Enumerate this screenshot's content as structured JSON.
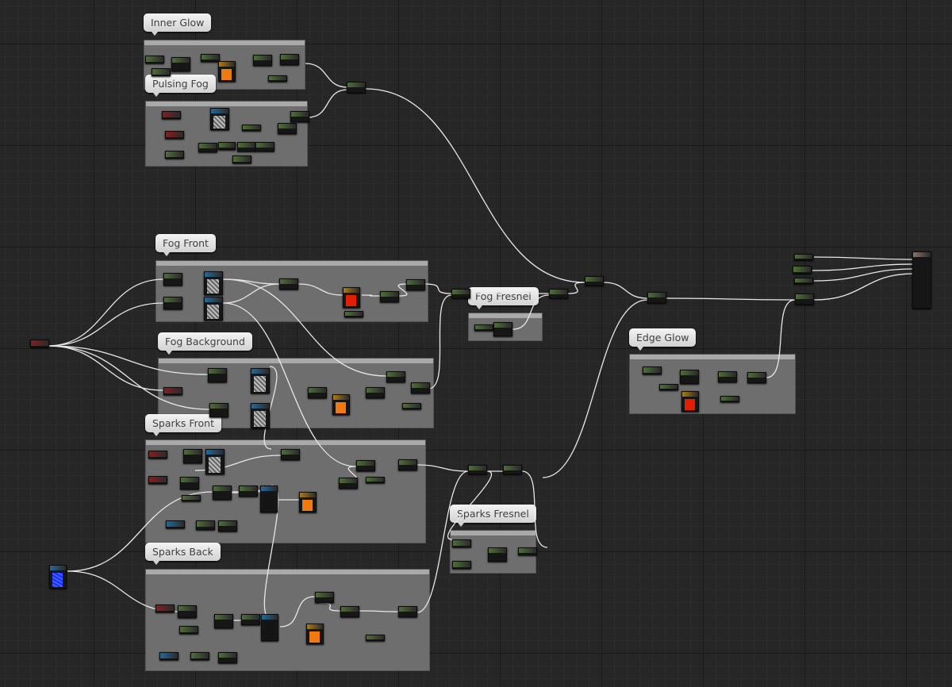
{
  "comments": [
    {
      "label": "Inner Glow"
    },
    {
      "label": "Pulsing Fog"
    },
    {
      "label": "Fog Front"
    },
    {
      "label": "Fog Background"
    },
    {
      "label": "Sparks Front"
    },
    {
      "label": "Sparks Back"
    },
    {
      "label": "Fog Fresnel"
    },
    {
      "label": "Edge Glow"
    },
    {
      "label": "Sparks Fresnel"
    }
  ],
  "colors": {
    "param_green": "#4e6e36",
    "vector_red": "#8a1c1c",
    "texture_blue": "#1f6a9e",
    "comment_gray": "#6e6e6e",
    "wire": "#e8e8e8",
    "preview_orange": "#f07a10",
    "preview_red": "#e02000",
    "output_tan": "#8a7566"
  }
}
